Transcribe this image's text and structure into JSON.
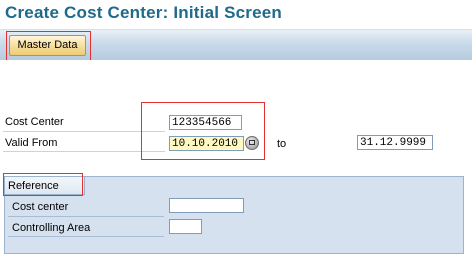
{
  "page_title": "Create Cost Center: Initial Screen",
  "toolbar": {
    "master_data_label": "Master Data"
  },
  "form": {
    "cost_center_label": "Cost Center",
    "cost_center_value": "123354566",
    "valid_from_label": "Valid From",
    "valid_from_value": "10.10.2010",
    "to_label": "to",
    "valid_to_value": "31.12.9999"
  },
  "reference": {
    "tab_label": "Reference",
    "cost_center_label": "Cost center",
    "cost_center_value": "",
    "controlling_area_label": "Controlling Area",
    "controlling_area_value": ""
  },
  "icons": {
    "value_help": "value-help-icon"
  },
  "colors": {
    "title": "#1e6a8a",
    "highlight": "#e53030",
    "required_field": "#fff8c0",
    "group_background": "#d5e1ee"
  }
}
